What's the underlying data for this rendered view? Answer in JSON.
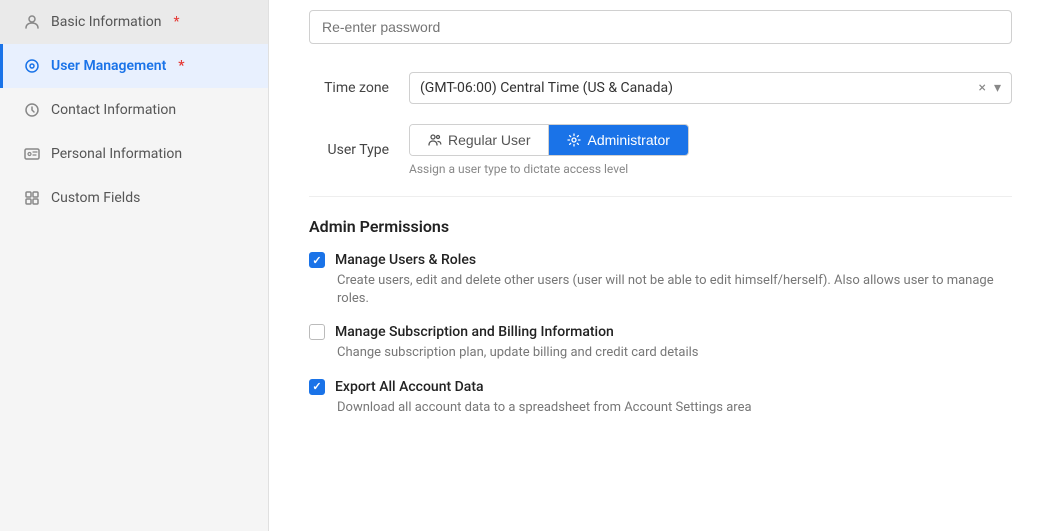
{
  "sidebar": {
    "items": [
      {
        "id": "basic-information",
        "label": "Basic Information",
        "required": true,
        "active": false,
        "icon": "person"
      },
      {
        "id": "user-management",
        "label": "User Management",
        "required": true,
        "active": true,
        "icon": "shield"
      },
      {
        "id": "contact-information",
        "label": "Contact Information",
        "required": false,
        "active": false,
        "icon": "clock"
      },
      {
        "id": "personal-information",
        "label": "Personal Information",
        "required": false,
        "active": false,
        "icon": "id-card"
      },
      {
        "id": "custom-fields",
        "label": "Custom Fields",
        "required": false,
        "active": false,
        "icon": "grid"
      }
    ]
  },
  "form": {
    "password_placeholder": "Re-enter password",
    "timezone_label": "Time zone",
    "timezone_value": "(GMT-06:00) Central Time (US & Canada)",
    "user_type_label": "User Type",
    "user_type_hint": "Assign a user type to dictate access level",
    "user_type_options": [
      {
        "id": "regular",
        "label": "Regular User",
        "active": false
      },
      {
        "id": "admin",
        "label": "Administrator",
        "active": true
      }
    ]
  },
  "admin_permissions": {
    "title": "Admin Permissions",
    "items": [
      {
        "id": "manage-users-roles",
        "label": "Manage Users & Roles",
        "description": "Create users, edit and delete other users (user will not be able to edit himself/herself). Also allows user to manage roles.",
        "checked": true
      },
      {
        "id": "manage-subscription-billing",
        "label": "Manage Subscription and Billing Information",
        "description": "Change subscription plan, update billing and credit card details",
        "checked": false
      },
      {
        "id": "export-account-data",
        "label": "Export All Account Data",
        "description": "Download all account data to a spreadsheet from Account Settings area",
        "checked": true
      }
    ]
  },
  "icons": {
    "person": "👤",
    "shield": "🛡",
    "clock": "🕐",
    "id_card": "📋",
    "grid": "⊞",
    "gear": "⚙",
    "users": "👥"
  }
}
